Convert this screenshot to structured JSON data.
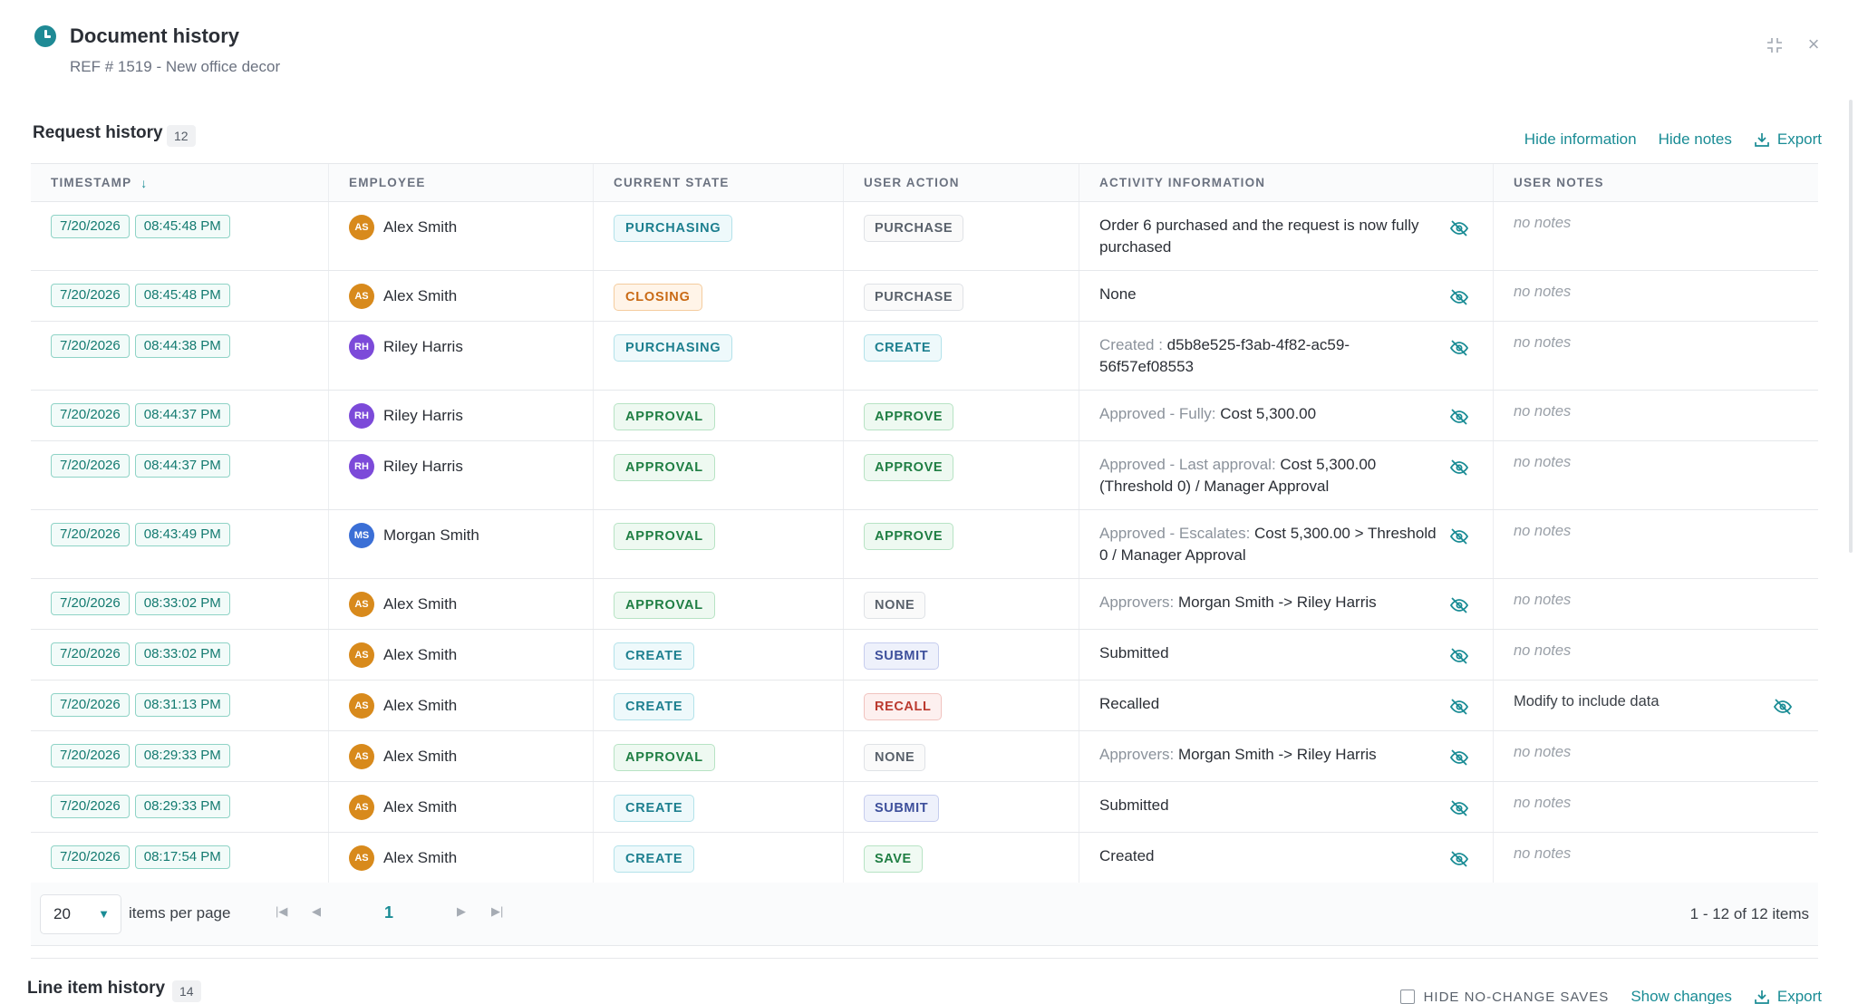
{
  "header": {
    "title": "Document history",
    "subtitle": "REF # 1519 - New office decor"
  },
  "request_history": {
    "title": "Request history",
    "count": "12",
    "hide_information": "Hide information",
    "hide_notes": "Hide notes",
    "export": "Export",
    "columns": [
      "TIMESTAMP",
      "EMPLOYEE",
      "CURRENT STATE",
      "USER ACTION",
      "ACTIVITY INFORMATION",
      "USER NOTES"
    ],
    "rows": [
      {
        "date": "7/20/2026",
        "time": "08:45:48 PM",
        "initials": "AS",
        "employee": "Alex Smith",
        "state": "PURCHASING",
        "action": "PURCHASE",
        "info_pre": "",
        "info": "Order 6 purchased and the request is now fully purchased",
        "notes": "no notes"
      },
      {
        "date": "7/20/2026",
        "time": "08:45:48 PM",
        "initials": "AS",
        "employee": "Alex Smith",
        "state": "CLOSING",
        "action": "PURCHASE",
        "info_pre": "",
        "info": "None",
        "notes": "no notes"
      },
      {
        "date": "7/20/2026",
        "time": "08:44:38 PM",
        "initials": "RH",
        "employee": "Riley Harris",
        "state": "PURCHASING",
        "action": "CREATE",
        "info_pre": "Created : ",
        "info": "d5b8e525-f3ab-4f82-ac59-56f57ef08553",
        "notes": "no notes"
      },
      {
        "date": "7/20/2026",
        "time": "08:44:37 PM",
        "initials": "RH",
        "employee": "Riley Harris",
        "state": "APPROVAL",
        "action": "APPROVE",
        "info_pre": "Approved - Fully: ",
        "info": "Cost 5,300.00",
        "notes": "no notes"
      },
      {
        "date": "7/20/2026",
        "time": "08:44:37 PM",
        "initials": "RH",
        "employee": "Riley Harris",
        "state": "APPROVAL",
        "action": "APPROVE",
        "info_pre": "Approved - Last approval: ",
        "info": "Cost 5,300.00 (Threshold 0) / Manager Approval",
        "notes": "no notes"
      },
      {
        "date": "7/20/2026",
        "time": "08:43:49 PM",
        "initials": "MS",
        "employee": "Morgan Smith",
        "state": "APPROVAL",
        "action": "APPROVE",
        "info_pre": "Approved - Escalates: ",
        "info": "Cost 5,300.00 > Threshold 0 / Manager Approval",
        "notes": "no notes"
      },
      {
        "date": "7/20/2026",
        "time": "08:33:02 PM",
        "initials": "AS",
        "employee": "Alex Smith",
        "state": "APPROVAL",
        "action": "NONE",
        "info_pre": "Approvers: ",
        "info": "Morgan Smith -> Riley Harris",
        "notes": "no notes"
      },
      {
        "date": "7/20/2026",
        "time": "08:33:02 PM",
        "initials": "AS",
        "employee": "Alex Smith",
        "state": "CREATE",
        "action": "SUBMIT",
        "info_pre": "",
        "info": "Submitted",
        "notes": "no notes"
      },
      {
        "date": "7/20/2026",
        "time": "08:31:13 PM",
        "initials": "AS",
        "employee": "Alex Smith",
        "state": "CREATE",
        "action": "RECALL",
        "info_pre": "",
        "info": "Recalled",
        "notes": "Modify to include data"
      },
      {
        "date": "7/20/2026",
        "time": "08:29:33 PM",
        "initials": "AS",
        "employee": "Alex Smith",
        "state": "APPROVAL",
        "action": "NONE",
        "info_pre": "Approvers: ",
        "info": "Morgan Smith -> Riley Harris",
        "notes": "no notes"
      },
      {
        "date": "7/20/2026",
        "time": "08:29:33 PM",
        "initials": "AS",
        "employee": "Alex Smith",
        "state": "CREATE",
        "action": "SUBMIT",
        "info_pre": "",
        "info": "Submitted",
        "notes": "no notes"
      },
      {
        "date": "7/20/2026",
        "time": "08:17:54 PM",
        "initials": "AS",
        "employee": "Alex Smith",
        "state": "CREATE",
        "action": "SAVE",
        "info_pre": "",
        "info": "Created",
        "notes": "no notes"
      }
    ]
  },
  "pager": {
    "per_page": "20",
    "per_page_label": "items per page",
    "current_page": "1",
    "range": "1 - 12 of 12 items"
  },
  "line_item_history": {
    "title": "Line item history",
    "count": "14",
    "hide_no_change": "HIDE NO-CHANGE SAVES",
    "show_changes": "Show changes",
    "export": "Export"
  },
  "colors": {
    "accent": "#1a8c95",
    "avatar_AS": "#d88a1c",
    "avatar_RH": "#7c4ad9",
    "avatar_MS": "#3b6fd6"
  },
  "icons": {
    "header": "clock-icon",
    "row_info": "eye-off-icon",
    "export": "download-icon",
    "close": "close-icon",
    "collapse": "collapse-icon"
  }
}
